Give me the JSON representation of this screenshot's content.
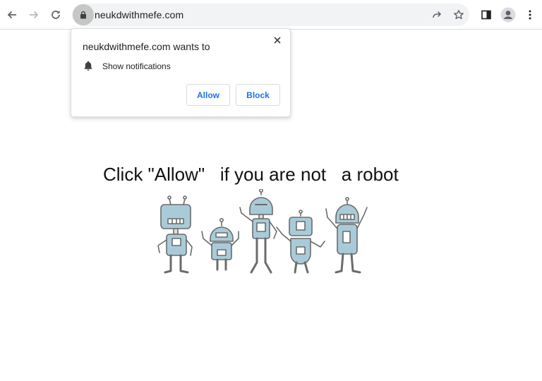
{
  "browser": {
    "url": "neukdwithmefe.com",
    "icons": [
      "back-icon",
      "forward-icon",
      "reload-icon",
      "lock-icon",
      "share-icon",
      "star-icon",
      "side-panel-icon",
      "profile-icon",
      "menu-icon"
    ]
  },
  "popup": {
    "title": "neukdwithmefe.com wants to",
    "permission": "Show notifications",
    "allow_label": "Allow",
    "block_label": "Block",
    "icons": [
      "bell-icon",
      "close-icon"
    ],
    "accent_color": "#1a73e8"
  },
  "page": {
    "headline": "Click \"Allow\"   if you are not   a robot",
    "robot_color": "#a9cbd9"
  }
}
